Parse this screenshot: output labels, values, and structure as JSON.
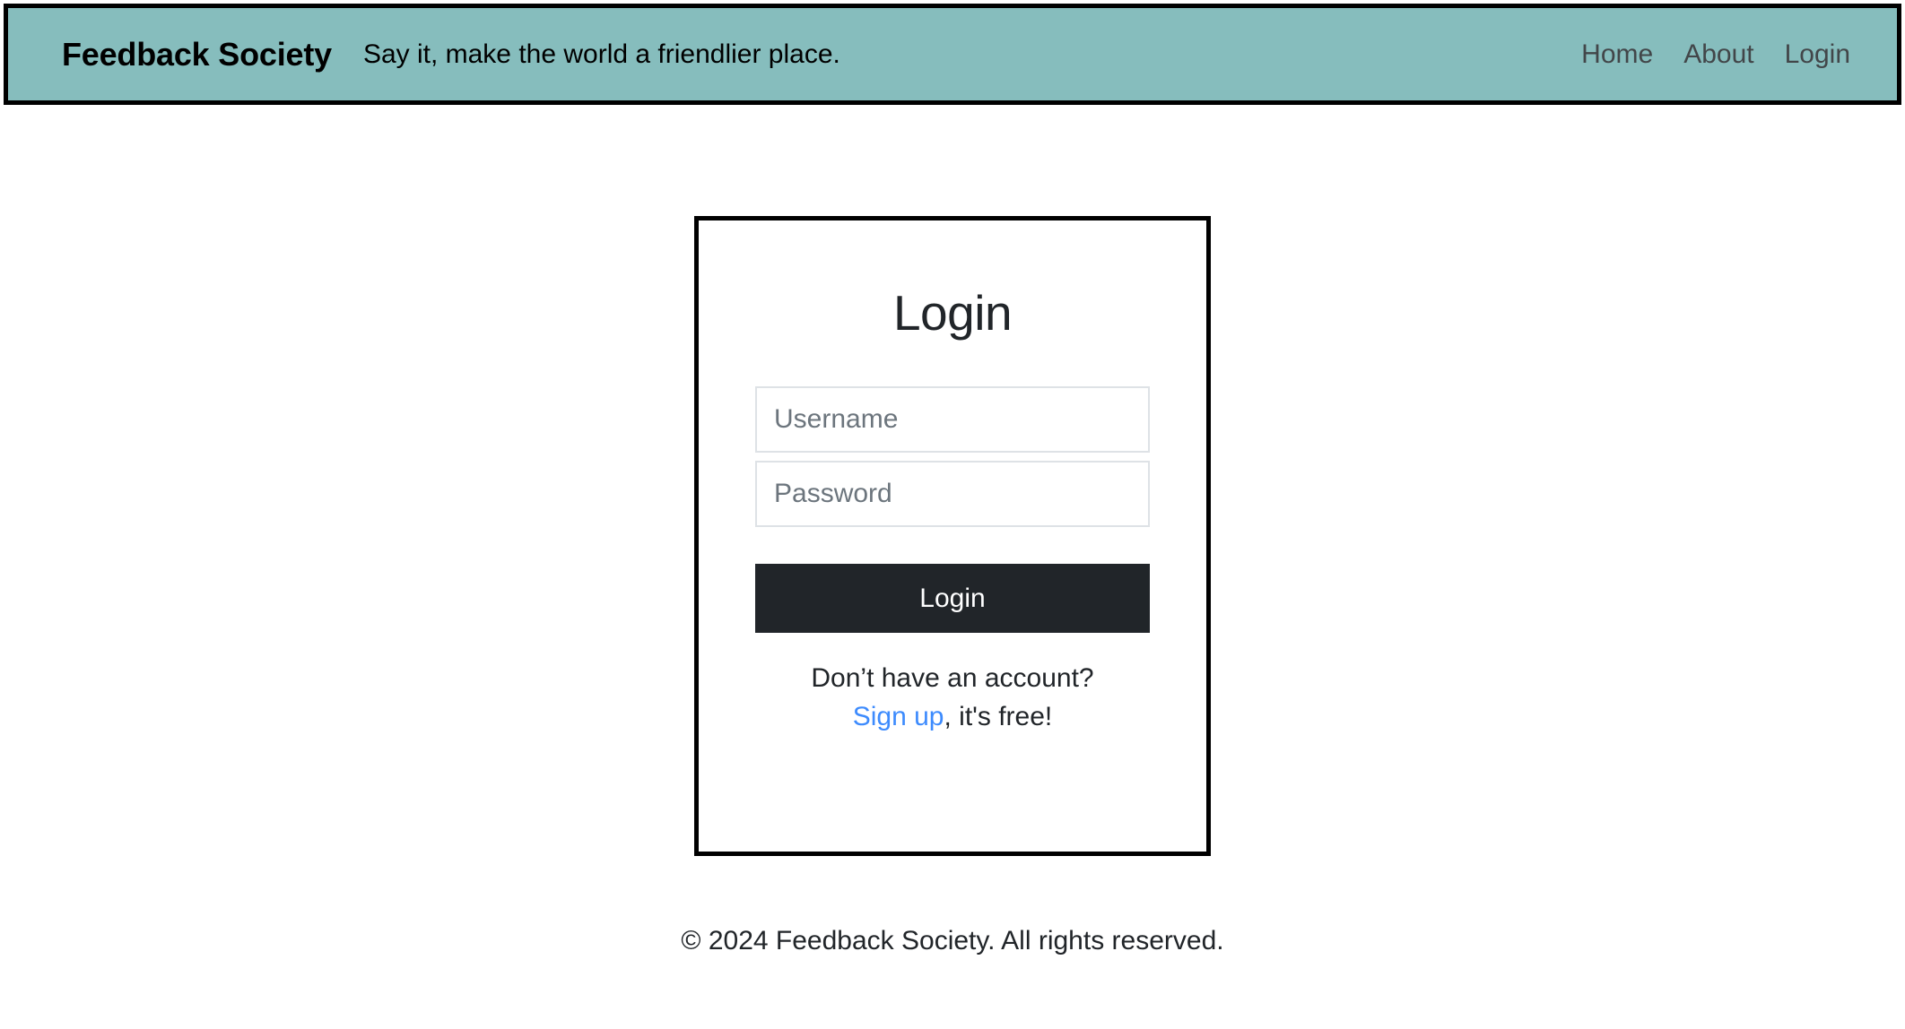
{
  "header": {
    "brand": "Feedback Society",
    "tagline": "Say it, make the world a friendlier place.",
    "background_color": "#86bdbd",
    "border_color": "#000000",
    "nav": [
      {
        "label": "Home"
      },
      {
        "label": "About"
      },
      {
        "label": "Login"
      }
    ]
  },
  "login_card": {
    "title": "Login",
    "username": {
      "placeholder": "Username",
      "value": ""
    },
    "password": {
      "placeholder": "Password",
      "value": ""
    },
    "submit_label": "Login",
    "submit_color": "#212529",
    "signup_prompt": "Don’t have an account?",
    "signup_link_label": "Sign up",
    "signup_suffix": ", it's free!",
    "link_color": "#3d8bfd"
  },
  "footer": {
    "copyright": "© 2024 Feedback Society. All rights reserved."
  }
}
